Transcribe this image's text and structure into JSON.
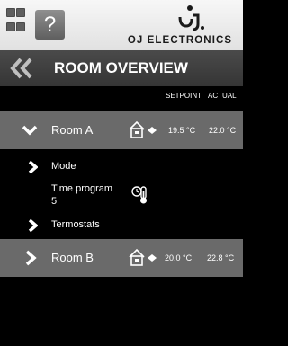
{
  "header": {
    "help_label": "?",
    "logo_text": "OJ ELECTRONICS"
  },
  "titlebar": {
    "title": "ROOM OVERVIEW"
  },
  "columns": {
    "setpoint": "SETPOINT",
    "actual": "ACTUAL"
  },
  "rooms": [
    {
      "name": "Room A",
      "setpoint": "19.5 °C",
      "actual": "22.0 °C",
      "expanded": true,
      "items": [
        {
          "label": "Mode"
        },
        {
          "label_line1": "Time program",
          "label_line2": "5"
        },
        {
          "label": "Termostats"
        }
      ]
    },
    {
      "name": "Room B",
      "setpoint": "20.0 °C",
      "actual": "22.8 °C",
      "expanded": false
    }
  ],
  "icons": {
    "grid": "grid-menu-icon",
    "help": "help-icon",
    "back": "double-chevron-left-icon",
    "expanded": "chevron-down-icon",
    "collapsed": "chevron-right-icon",
    "house": "house-thermostat-icon",
    "time_program": "clock-thermometer-icon"
  }
}
